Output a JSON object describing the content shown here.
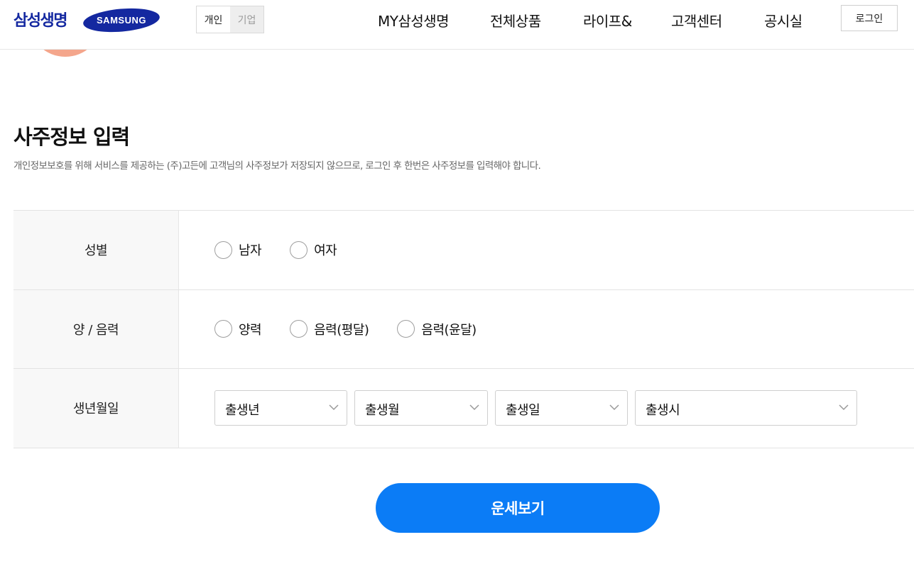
{
  "header": {
    "logo_text": "삼성생명",
    "samsung_logo_text": "SAMSUNG",
    "segments": [
      {
        "label": "개인",
        "active": true
      },
      {
        "label": "기업",
        "active": false
      }
    ],
    "nav": [
      "MY삼성생명",
      "전체상품",
      "라이프&",
      "고객센터",
      "공시실"
    ],
    "login_label": "로그인"
  },
  "section": {
    "title": "사주정보 입력",
    "description": "개인정보보호를 위해 서비스를 제공하는 (주)고든에 고객님의 사주정보가 저장되지 않으므로, 로그인 후 한번은 사주정보를 입력해야 합니다."
  },
  "form": {
    "gender": {
      "label": "성별",
      "options": [
        "남자",
        "여자"
      ]
    },
    "calendar": {
      "label": "양 / 음력",
      "options": [
        "양력",
        "음력(평달)",
        "음력(윤달)"
      ]
    },
    "birth": {
      "label": "생년월일",
      "selects": [
        "출생년",
        "출생월",
        "출생일",
        "출생시"
      ]
    }
  },
  "cta_label": "운세보기",
  "colors": {
    "brand": "#1428a0",
    "accent": "#0b7cf6",
    "peach": "#f4a68c"
  }
}
